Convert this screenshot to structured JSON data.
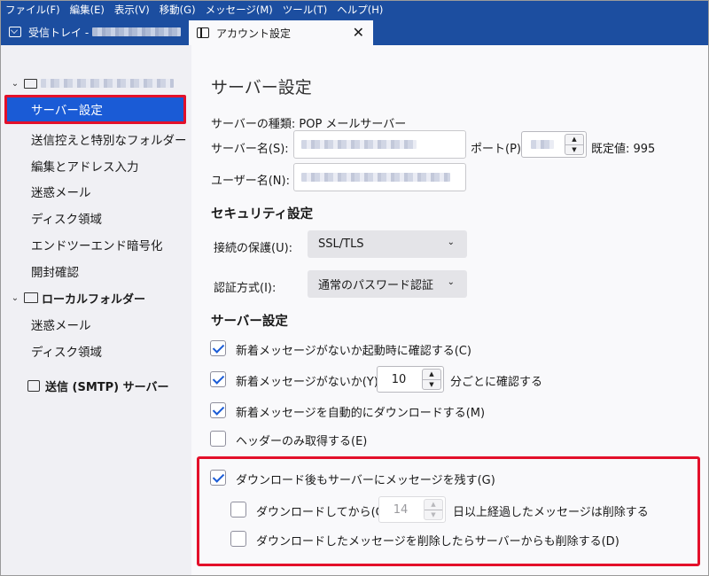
{
  "menubar": [
    "ファイル(F)",
    "編集(E)",
    "表示(V)",
    "移動(G)",
    "メッセージ(M)",
    "ツール(T)",
    "ヘルプ(H)"
  ],
  "tabs": {
    "inbox_label": "受信トレイ -",
    "account_label": "アカウント設定",
    "close_symbol": "✕"
  },
  "sidebar": {
    "account_twisty": "⌄",
    "selected_item": "サーバー設定",
    "account_items": [
      "送信控えと特別なフォルダー",
      "編集とアドレス入力",
      "迷惑メール",
      "ディスク領域",
      "エンドツーエンド暗号化",
      "開封確認"
    ],
    "local_folders_label": "ローカルフォルダー",
    "local_items": [
      "迷惑メール",
      "ディスク領域"
    ],
    "smtp_label": "送信 (SMTP) サーバー"
  },
  "main": {
    "title": "サーバー設定",
    "server_type": "サーバーの種類: POP メールサーバー",
    "server_name_label": "サーバー名(S):",
    "port_label": "ポート(P):",
    "default_port": "既定値: 995",
    "username_label": "ユーザー名(N):",
    "security_heading": "セキュリティ設定",
    "connection_label": "接続の保護(U):",
    "connection_value": "SSL/TLS",
    "auth_label": "認証方式(I):",
    "auth_value": "通常のパスワード認証",
    "server_heading": "サーバー設定",
    "opt_startup": "新着メッセージがないか起動時に確認する(C)",
    "opt_interval_prefix": "新着メッセージがないか(Y)",
    "interval_value": "10",
    "opt_interval_suffix": "分ごとに確認する",
    "opt_auto_download": "新着メッセージを自動的にダウンロードする(M)",
    "opt_headers_only": "ヘッダーのみ取得する(E)",
    "opt_leave_on_server": "ダウンロード後もサーバーにメッセージを残す(G)",
    "opt_delete_after_prefix": "ダウンロードしてから(O)",
    "days_value": "14",
    "opt_delete_after_suffix": "日以上経過したメッセージは削除する",
    "opt_delete_when_deleted": "ダウンロードしたメッセージを削除したらサーバーからも削除する(D)"
  },
  "state": {
    "startup_checked": true,
    "interval_checked": true,
    "auto_download_checked": true,
    "headers_only_checked": false,
    "leave_on_server_checked": true,
    "delete_after_checked": false,
    "delete_when_deleted_checked": false
  },
  "colors": {
    "accent": "#1c4ea0",
    "selection": "#1a5bd6",
    "highlight_outline": "#e3102a"
  },
  "icons": {
    "spin_up": "▲",
    "spin_down": "▼",
    "select_chevron": "⌄"
  }
}
